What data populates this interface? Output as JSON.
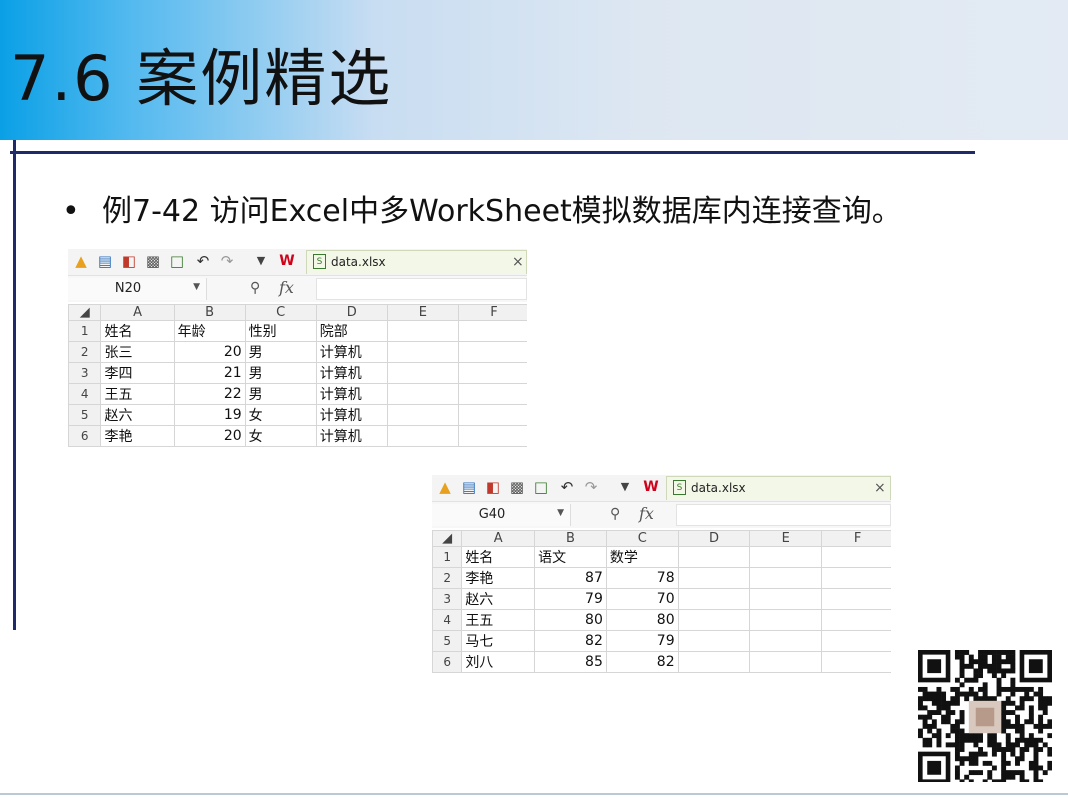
{
  "slide": {
    "title": "7.6  案例精选",
    "bullet": "•",
    "text": "例7-42  访问Excel中多WorkSheet模拟数据库内连接查询。"
  },
  "colors": {
    "title_rule": "#1f2a6b",
    "header_gradient_start": "#0aa0e6",
    "tab_background": "#f3f7e8"
  },
  "sheets": [
    {
      "tab_name": "data.xlsx",
      "name_box": "N20",
      "fx_label": "fx",
      "columns": [
        "A",
        "B",
        "C",
        "D",
        "E",
        "F"
      ],
      "rows": [
        {
          "n": "1",
          "cells": [
            "姓名",
            "年龄",
            "性别",
            "院部",
            "",
            ""
          ]
        },
        {
          "n": "2",
          "cells": [
            "张三",
            "20",
            "男",
            "计算机",
            "",
            ""
          ]
        },
        {
          "n": "3",
          "cells": [
            "李四",
            "21",
            "男",
            "计算机",
            "",
            ""
          ]
        },
        {
          "n": "4",
          "cells": [
            "王五",
            "22",
            "男",
            "计算机",
            "",
            ""
          ]
        },
        {
          "n": "5",
          "cells": [
            "赵六",
            "19",
            "女",
            "计算机",
            "",
            ""
          ]
        },
        {
          "n": "6",
          "cells": [
            "李艳",
            "20",
            "女",
            "计算机",
            "",
            ""
          ]
        }
      ],
      "numeric_columns": [
        1
      ]
    },
    {
      "tab_name": "data.xlsx",
      "name_box": "G40",
      "fx_label": "fx",
      "columns": [
        "A",
        "B",
        "C",
        "D",
        "E",
        "F"
      ],
      "rows": [
        {
          "n": "1",
          "cells": [
            "姓名",
            "语文",
            "数学",
            "",
            "",
            ""
          ]
        },
        {
          "n": "2",
          "cells": [
            "李艳",
            "87",
            "78",
            "",
            "",
            ""
          ]
        },
        {
          "n": "3",
          "cells": [
            "赵六",
            "79",
            "70",
            "",
            "",
            ""
          ]
        },
        {
          "n": "4",
          "cells": [
            "王五",
            "80",
            "80",
            "",
            "",
            ""
          ]
        },
        {
          "n": "5",
          "cells": [
            "马七",
            "82",
            "79",
            "",
            "",
            ""
          ]
        },
        {
          "n": "6",
          "cells": [
            "刘八",
            "85",
            "82",
            "",
            "",
            ""
          ]
        }
      ],
      "numeric_columns": [
        1,
        2
      ]
    }
  ],
  "icons": [
    "open-folder-icon",
    "save-icon",
    "export-icon",
    "print-icon",
    "print-preview-icon",
    "undo-icon",
    "redo-icon",
    "dropdown-icon",
    "wps-logo-icon",
    "excel-file-icon",
    "close-icon",
    "zoom-icon",
    "qr-code-icon"
  ]
}
